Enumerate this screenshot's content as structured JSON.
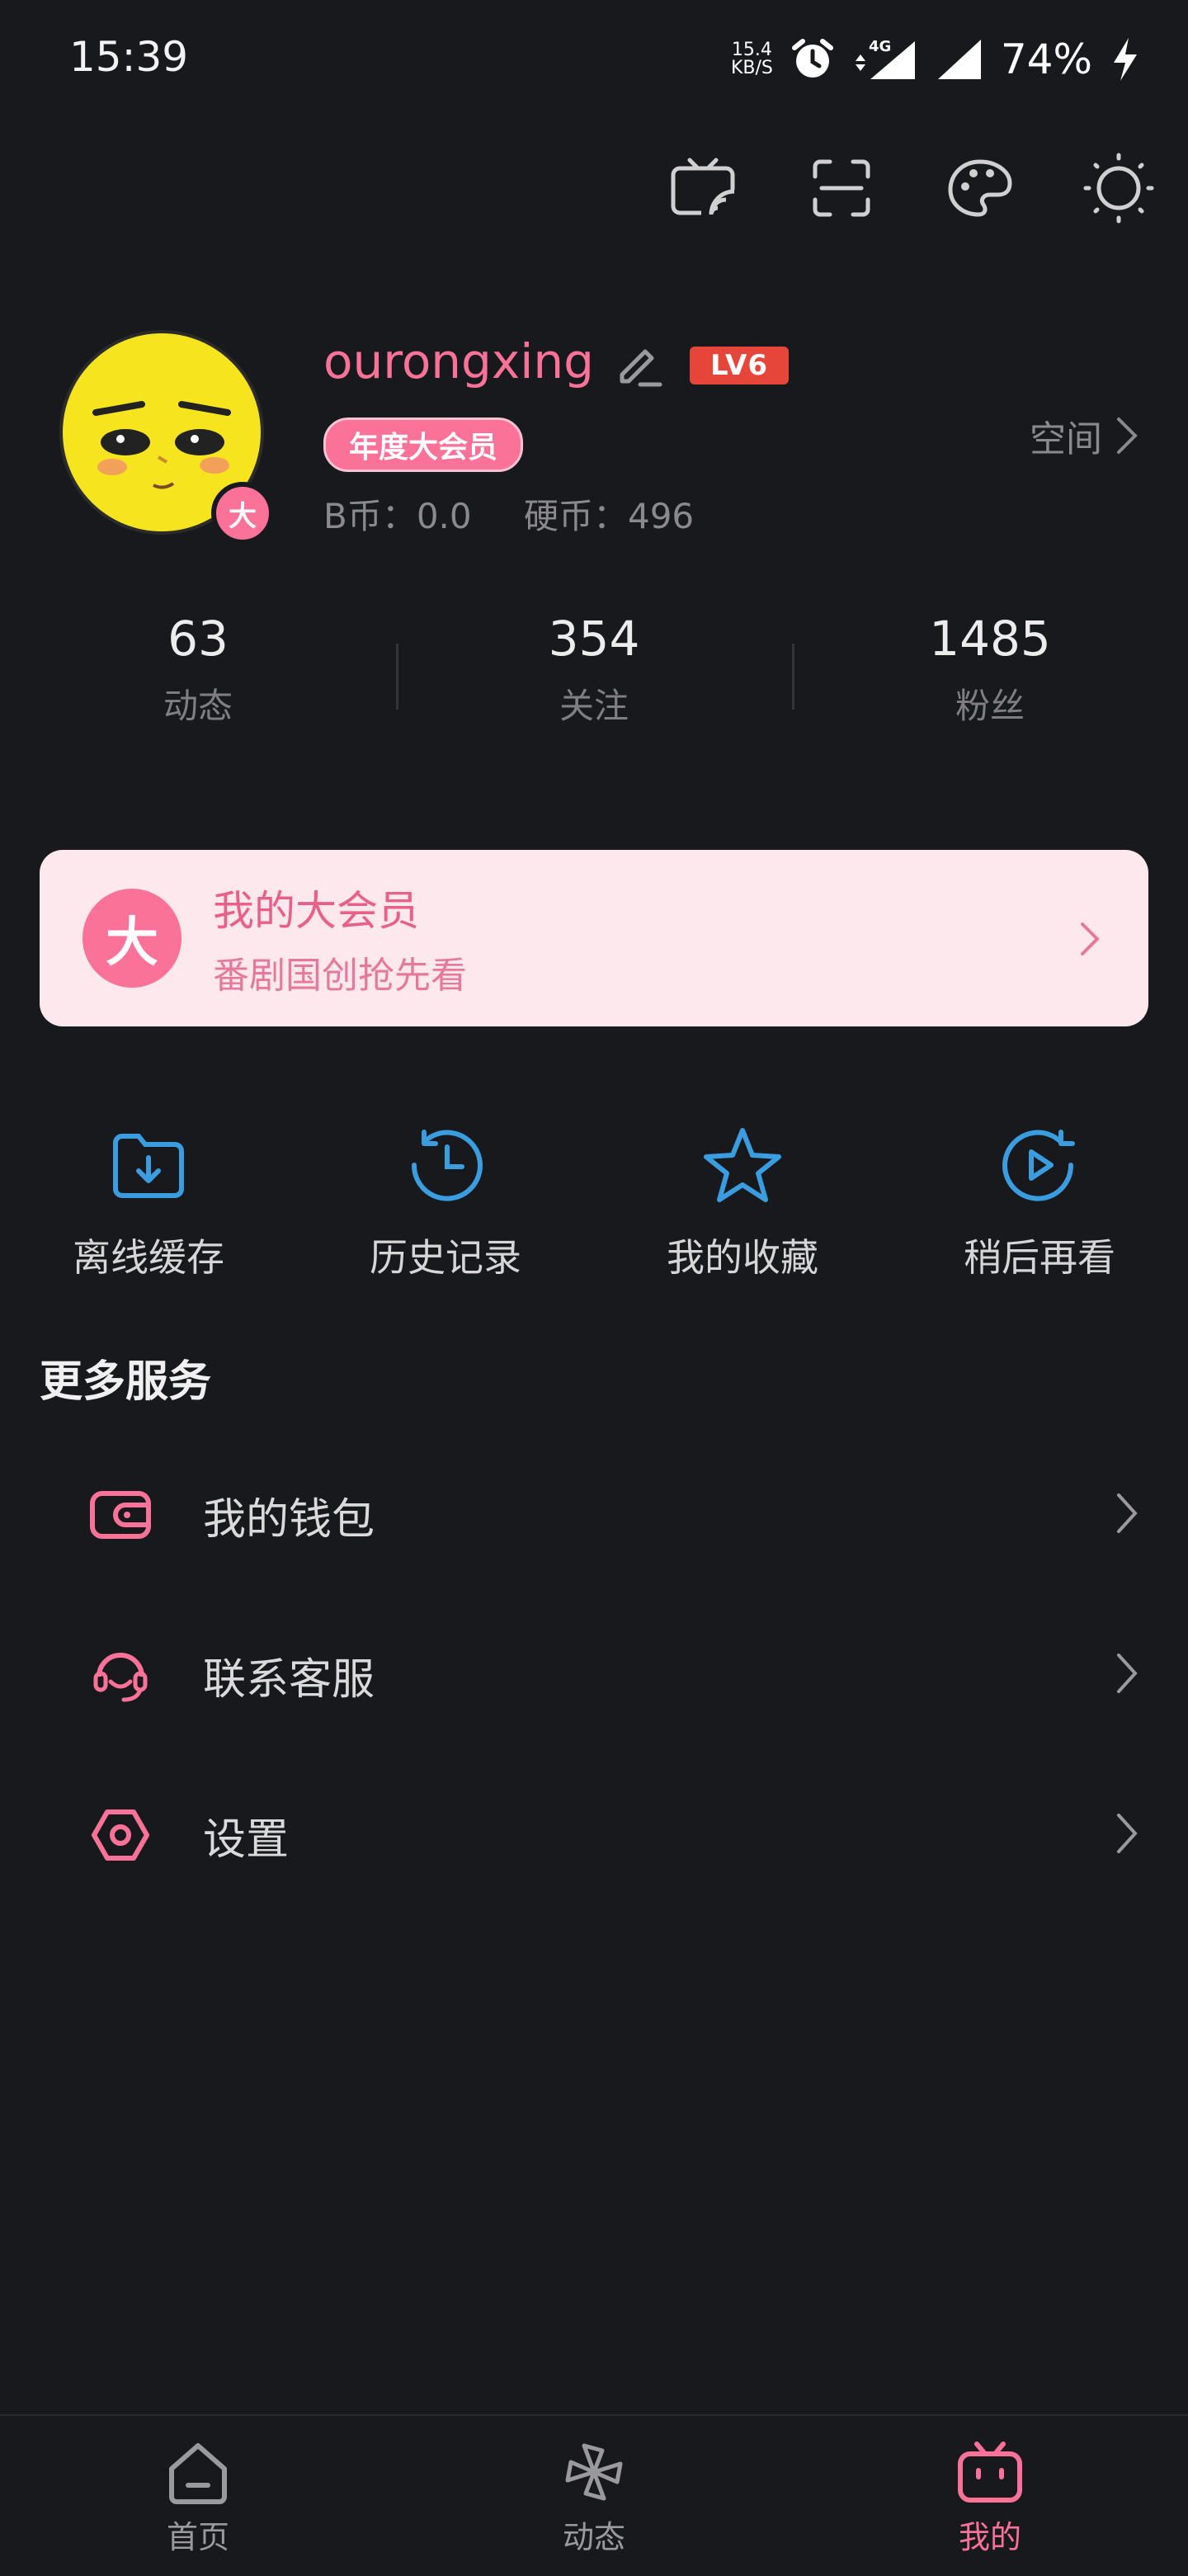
{
  "status_bar": {
    "time": "15:39",
    "net_speed_value": "15.4",
    "net_speed_unit": "KB/S",
    "network_type": "4G",
    "battery": "74%"
  },
  "toolbar": {
    "icons": [
      "cast-tv-icon",
      "scan-icon",
      "theme-palette-icon",
      "night-mode-icon"
    ]
  },
  "profile": {
    "username": "ourongxing",
    "level": "LV6",
    "vip_tag": "年度大会员",
    "avatar_badge": "大",
    "b_coins": "B币：0.0",
    "coins": "硬币：496",
    "space_link": "空间"
  },
  "stats": [
    {
      "value": "63",
      "label": "动态"
    },
    {
      "value": "354",
      "label": "关注"
    },
    {
      "value": "1485",
      "label": "粉丝"
    }
  ],
  "vip_banner": {
    "badge": "大",
    "title": "我的大会员",
    "subtitle": "番剧国创抢先看"
  },
  "shortcuts": [
    {
      "label": "离线缓存",
      "icon": "offline-download-icon"
    },
    {
      "label": "历史记录",
      "icon": "history-icon"
    },
    {
      "label": "我的收藏",
      "icon": "favorite-star-icon"
    },
    {
      "label": "稍后再看",
      "icon": "watch-later-icon"
    }
  ],
  "more_services": {
    "title": "更多服务",
    "items": [
      {
        "label": "我的钱包",
        "icon": "wallet-icon"
      },
      {
        "label": "联系客服",
        "icon": "customer-service-icon"
      },
      {
        "label": "设置",
        "icon": "settings-icon"
      }
    ]
  },
  "bottom_nav": [
    {
      "label": "首页",
      "icon": "home-icon"
    },
    {
      "label": "动态",
      "icon": "pinwheel-icon"
    },
    {
      "label": "我的",
      "icon": "bilibili-tv-icon",
      "active": true
    }
  ],
  "colors": {
    "accent_pink": "#fb7299",
    "accent_blue": "#3a9de0",
    "background": "#18191c"
  }
}
